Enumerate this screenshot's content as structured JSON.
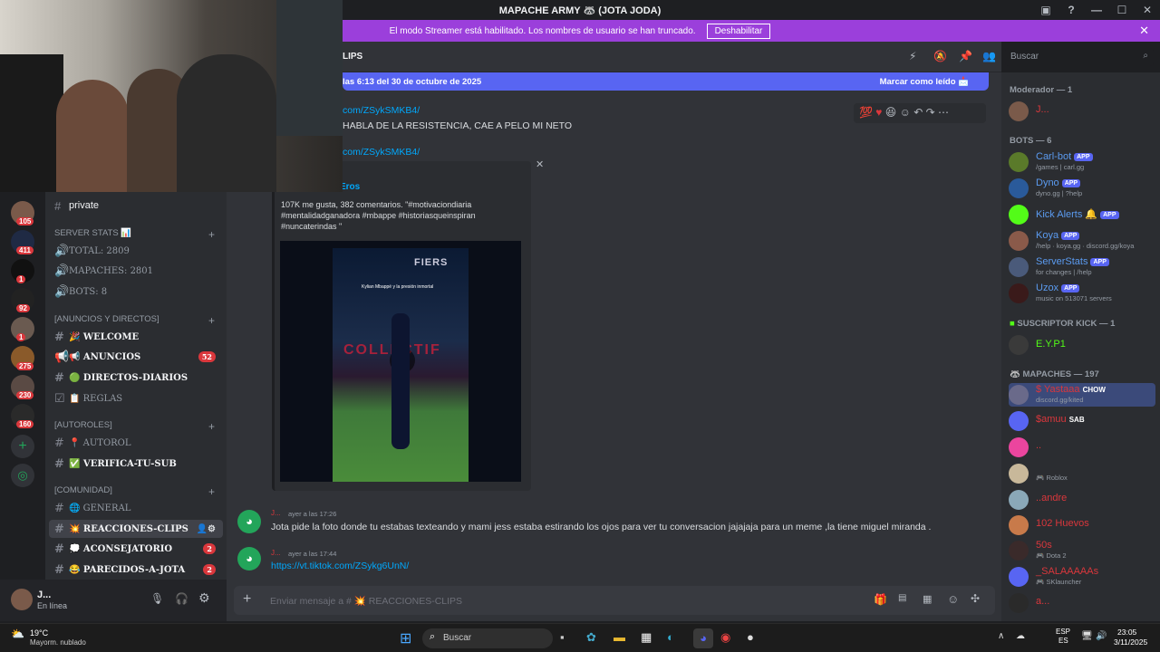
{
  "window": {
    "title": "MAPACHE ARMY 🦝 (JOTA JODA)",
    "controls": [
      "—",
      "☐",
      "✕"
    ]
  },
  "streamer_bar": {
    "text": "El modo Streamer está habilitado. Los nombres de usuario se han truncado.",
    "button": "Deshabilitar"
  },
  "channel_header": {
    "name": "LIPS"
  },
  "new_messages_bar": {
    "text": "las 6:13 del 30 de octubre de 2025",
    "action": "Marcar como leído"
  },
  "search": {
    "placeholder": "Buscar"
  },
  "servers": {
    "badges": [
      "105",
      "411",
      "1",
      "92",
      "1",
      "275",
      "230",
      "160"
    ]
  },
  "channels": {
    "top_channel": "private",
    "categories": [
      {
        "label": "SERVER STATS 📊",
        "items": [
          "TOTAL: 2809",
          "MAPACHES: 2801",
          "BOTS: 8"
        ]
      },
      {
        "label": "[ANUNCIOS Y DIRECTOS]",
        "items": [
          {
            "name": "🎉 WELCOME"
          },
          {
            "name": "📢 ANUNCIOS",
            "badge": "52"
          },
          {
            "name": "🟢 DIRECTOS-DIARIOS"
          },
          {
            "name": "📋 REGLAS"
          }
        ]
      },
      {
        "label": "[AUTOROLES]",
        "items": [
          {
            "name": "📍 AUTOROL"
          },
          {
            "name": "✅ VERIFICA-TU-SUB"
          }
        ]
      },
      {
        "label": "[COMUNIDAD]",
        "items": [
          {
            "name": "🌐 GENERAL"
          },
          {
            "name": "💥 REACCIONES-CLIPS"
          },
          {
            "name": "💭 ACONSEJATORIO",
            "badge": "2"
          },
          {
            "name": "😂 PARECIDOS-A-JOTA",
            "badge": "2"
          }
        ]
      }
    ]
  },
  "user_panel": {
    "name": "J...",
    "status": "En línea"
  },
  "messages": {
    "link_1": "com/ZSykSMKB4/",
    "text_1": "HABLA DE LA RESISTENCIA, CAE A PELO MI NETO",
    "link_2": "com/ZSykSMKB4/",
    "embed": {
      "author": "Eros",
      "description_1": "107K me gusta, 382 comentarios. \"#motivaciondiaria",
      "description_2": "#mentalidadganadora #mbappe #historiasqueinspiran",
      "description_3": "#nuncaterindas \"",
      "video_caption": "Kylian Mbappé y la presión inmortal",
      "video_banner": "COLLECTIF",
      "video_ad": "FIERS"
    },
    "msg_a": {
      "author": "J...",
      "time": "ayer a las 17:26",
      "text": "Jota pide la foto donde tu estabas texteando y mami jess estaba estirando los ojos para ver tu conversacion jajajaja para un meme ,la tiene miguel miranda ."
    },
    "msg_b": {
      "author": "J...",
      "time": "ayer a las 17:44",
      "link": "https://vt.tiktok.com/ZSykg6UnN/"
    }
  },
  "composer": {
    "placeholder": "Enviar mensaje a # 💥 REACCIONES-CLIPS"
  },
  "members": {
    "moderator": {
      "label": "Moderador — 1",
      "name": "J..."
    },
    "bots_label": "BOTS — 6",
    "bots": [
      {
        "name": "Carl-bot",
        "sub": "/games | carl.gg"
      },
      {
        "name": "Dyno",
        "sub": "dyno.gg | ?help"
      },
      {
        "name": "Kick Alerts 🔔",
        "sub": ""
      },
      {
        "name": "Koya",
        "sub": "/help · koya.gg · discord.gg/koya"
      },
      {
        "name": "ServerStats",
        "sub": "for changes | /help"
      },
      {
        "name": "Uzox",
        "sub": "music on 513071 servers"
      }
    ],
    "app_tag": "APP",
    "kick_label": "SUSCRIPTOR KICK — 1",
    "kick_member": "E.Y.P1",
    "mapaches_label": "MAPACHES — 197",
    "mapaches": [
      {
        "name": "$ Yastaaa",
        "tag": "CHOW",
        "sub": "discord.gg/kited"
      },
      {
        "name": "$amuu",
        "tag": "SAB",
        "sub": ""
      },
      {
        "name": "..",
        "tag": "",
        "sub": ""
      },
      {
        "name": "",
        "tag": "",
        "sub": "Roblox"
      },
      {
        "name": "..andre",
        "tag": "",
        "sub": ""
      },
      {
        "name": "102 Huevos",
        "tag": "",
        "sub": ""
      },
      {
        "name": "50s",
        "tag": "",
        "sub": "Dota 2"
      },
      {
        "name": "_SALAAAAAs",
        "tag": "",
        "sub": "SKlauncher"
      },
      {
        "name": "a...",
        "tag": "",
        "sub": ""
      }
    ]
  },
  "taskbar": {
    "weather_temp": "19°C",
    "weather_text": "Mayorm. nublado",
    "search": "Buscar",
    "lang_1": "ESP",
    "lang_2": "ES",
    "time": "23:05",
    "date": "3/11/2025"
  },
  "colors": {
    "accent": "#5865f2",
    "streamer": "#9b3fdb",
    "badge": "#da373c",
    "link": "#00a8fc"
  }
}
